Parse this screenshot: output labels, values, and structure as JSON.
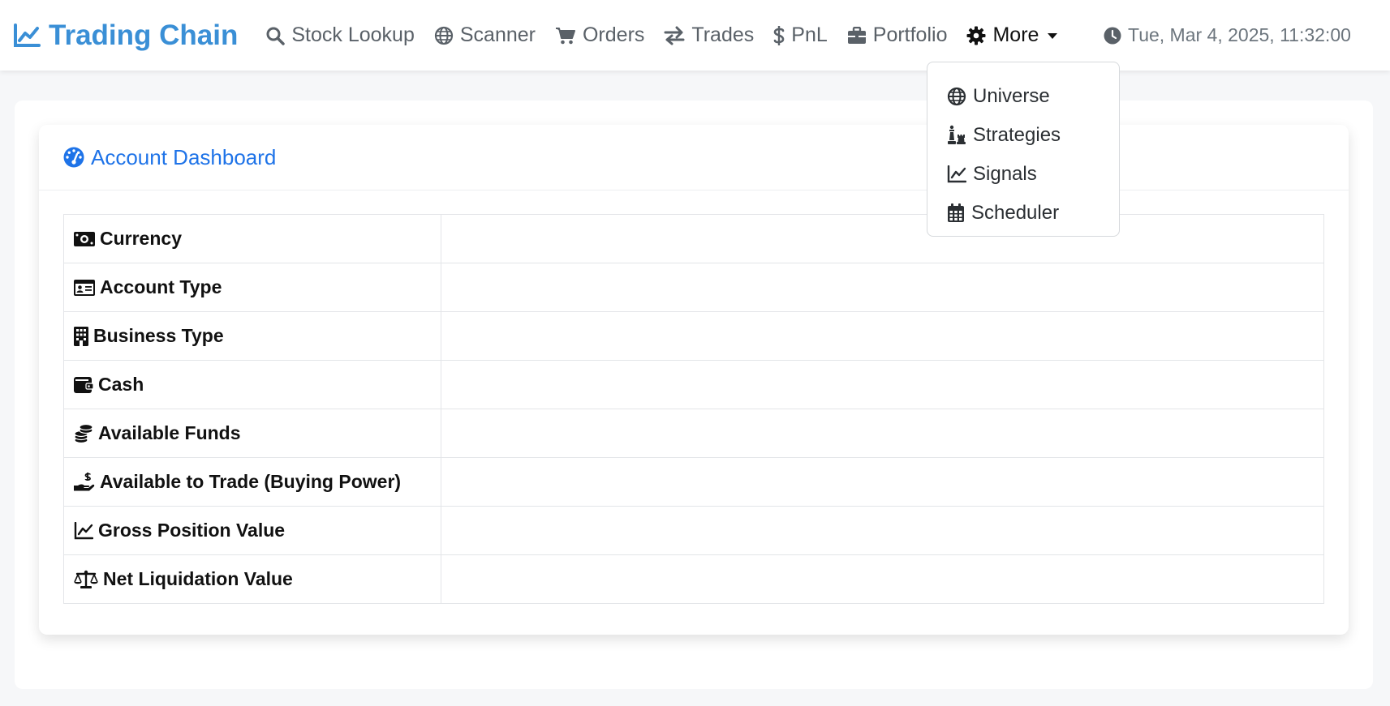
{
  "navbar": {
    "brand": "Trading Chain",
    "items": [
      {
        "label": "Stock Lookup",
        "icon": "search-icon"
      },
      {
        "label": "Scanner",
        "icon": "globe-icon"
      },
      {
        "label": "Orders",
        "icon": "cart-icon"
      },
      {
        "label": "Trades",
        "icon": "arrows-exchange-icon"
      },
      {
        "label": "PnL",
        "icon": "dollar-icon"
      },
      {
        "label": "Portfolio",
        "icon": "briefcase-icon"
      }
    ],
    "more_label": "More",
    "clock": "Tue, Mar 4, 2025, 11:32:00"
  },
  "more_menu": {
    "items": [
      {
        "label": "Universe",
        "icon": "globe-icon"
      },
      {
        "label": "Strategies",
        "icon": "chess-icon"
      },
      {
        "label": "Signals",
        "icon": "line-chart-icon"
      },
      {
        "label": "Scheduler",
        "icon": "calendar-icon"
      }
    ]
  },
  "dashboard": {
    "title": "Account Dashboard",
    "rows": [
      {
        "label": "Currency",
        "value": "",
        "icon": "money-bill-icon"
      },
      {
        "label": "Account Type",
        "value": "",
        "icon": "id-card-icon"
      },
      {
        "label": "Business Type",
        "value": "",
        "icon": "building-icon"
      },
      {
        "label": "Cash",
        "value": "",
        "icon": "wallet-icon"
      },
      {
        "label": "Available Funds",
        "value": "",
        "icon": "coins-icon"
      },
      {
        "label": "Available to Trade (Buying Power)",
        "value": "",
        "icon": "hand-dollar-icon"
      },
      {
        "label": "Gross Position Value",
        "value": "",
        "icon": "line-chart-icon"
      },
      {
        "label": "Net Liquidation Value",
        "value": "",
        "icon": "scale-icon"
      }
    ]
  },
  "colors": {
    "brand": "#3a8fd6",
    "header_accent": "#1e73e8",
    "nav_text": "#5a6168"
  }
}
